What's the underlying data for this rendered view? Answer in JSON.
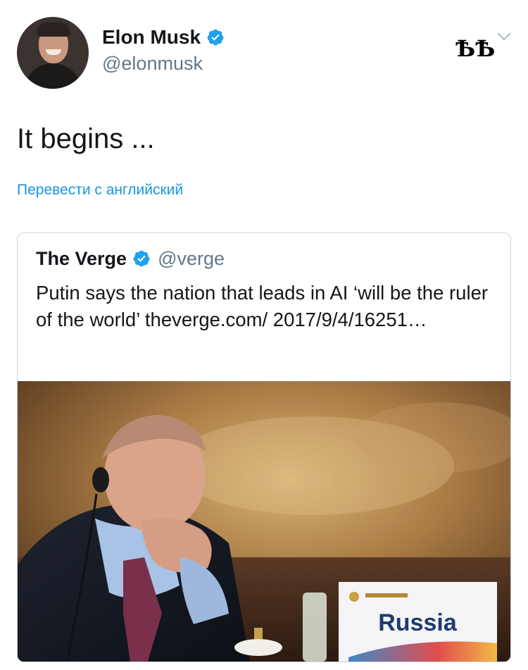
{
  "author": {
    "display_name": "Elon Musk",
    "handle": "@elonmusk",
    "avatar_icon": "user-avatar-photo",
    "verified_icon": "verified-badge-icon"
  },
  "flair_text": "ѢѢ",
  "menu_icon": "chevron-down-icon",
  "tweet": {
    "text": "It begins ...",
    "translate_label": "Перевести с английский"
  },
  "quote": {
    "display_name": "The Verge",
    "handle": "@verge",
    "text": "Putin says the nation that leads in AI ‘will be the ruler of the world’ theverge.com/ 2017/9/4/16251…",
    "verified_icon": "verified-badge-icon",
    "image": {
      "icon": "news-photo",
      "placard_text": "Russia"
    }
  },
  "colors": {
    "link": "#1b95e0",
    "verified": "#1da1f2",
    "secondary_text": "#657786",
    "border": "#ccd6dd"
  }
}
